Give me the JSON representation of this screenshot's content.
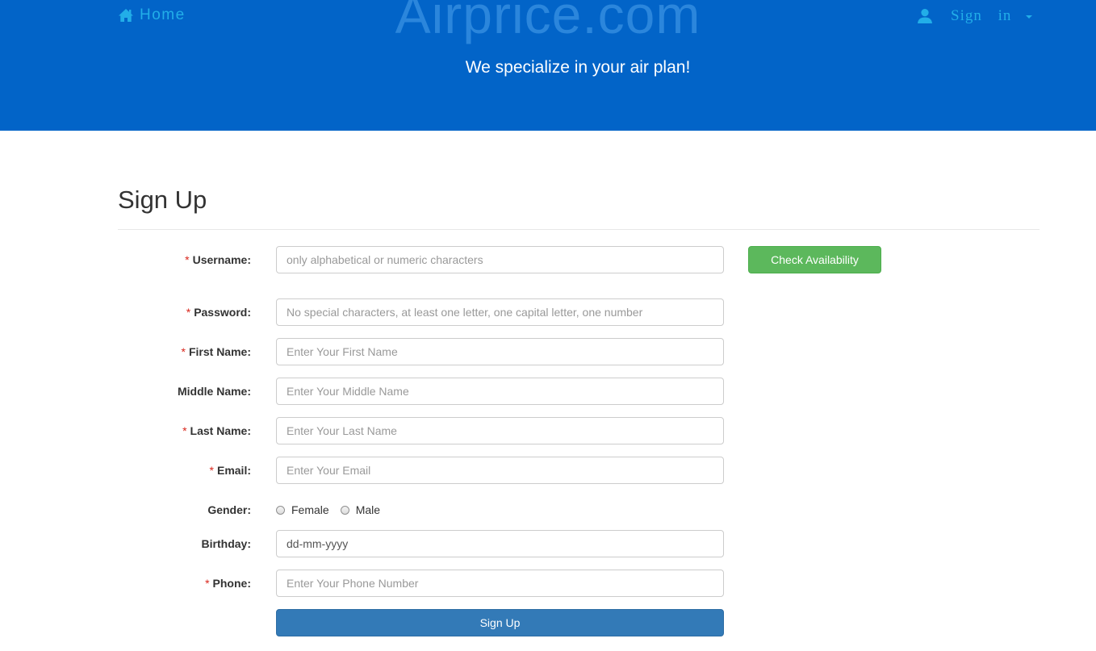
{
  "header": {
    "home_label": "Home",
    "brand": "Airprice.com",
    "tagline": "We specialize in your air plan!",
    "signin_label": "Sign in",
    "icons": {
      "home": "home-icon",
      "user": "user-icon",
      "caret": "caret-down-icon"
    },
    "colors": {
      "banner": "#0264c8",
      "nav_link": "#22aee8"
    }
  },
  "page": {
    "title": "Sign Up"
  },
  "form": {
    "required_marker": "*",
    "username": {
      "label": "Username:",
      "placeholder": "only alphabetical or numeric characters"
    },
    "check_button": "Check Availability",
    "password": {
      "label": "Password:",
      "placeholder": "No special characters, at least one letter, one capital letter, one number"
    },
    "first_name": {
      "label": "First Name:",
      "placeholder": "Enter Your First Name"
    },
    "middle_name": {
      "label": "Middle Name:",
      "placeholder": "Enter Your Middle Name"
    },
    "last_name": {
      "label": "Last Name:",
      "placeholder": "Enter Your Last Name"
    },
    "email": {
      "label": "Email:",
      "placeholder": "Enter Your Email"
    },
    "gender": {
      "label": "Gender:",
      "options": [
        "Female",
        "Male"
      ]
    },
    "birthday": {
      "label": "Birthday:",
      "value": "dd-mm-yyyy"
    },
    "phone": {
      "label": "Phone:",
      "placeholder": "Enter Your Phone Number"
    },
    "submit_button": "Sign Up",
    "colors": {
      "check_button": "#5cb85c",
      "submit_button": "#337ab7",
      "required": "#d9261c"
    }
  }
}
